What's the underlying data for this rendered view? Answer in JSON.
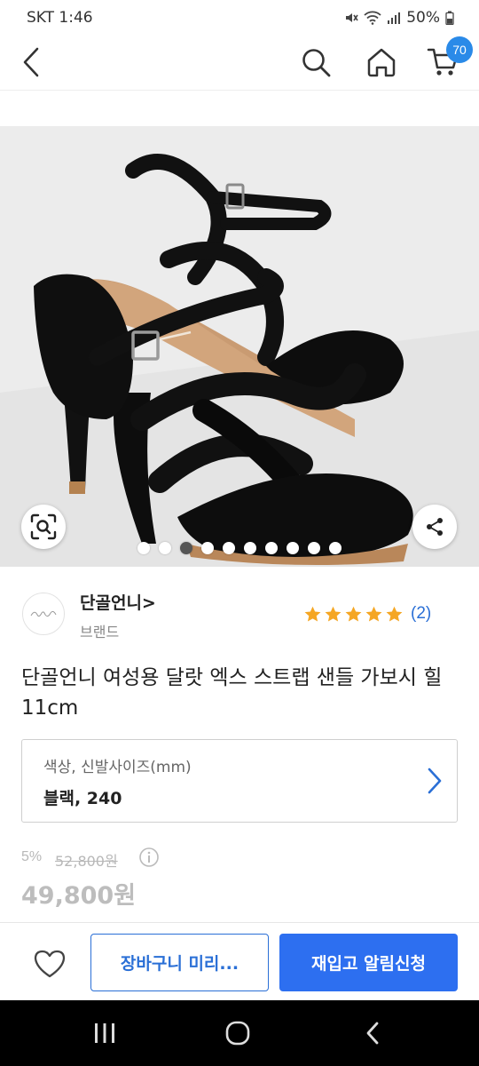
{
  "status_bar": {
    "carrier_time": "SKT 1:46",
    "battery": "50%",
    "icons": [
      "mute-icon",
      "wifi-icon",
      "signal-icon",
      "battery-icon"
    ]
  },
  "app_bar": {
    "icons": [
      "back-arrow-icon",
      "search-icon",
      "home-icon",
      "cart-icon"
    ],
    "cart_count": "70",
    "badge_color": "#2a8ae8"
  },
  "product_image": {
    "subject": "black strappy high-heel sandals",
    "slide_count": 10,
    "active_slide": 3
  },
  "brand": {
    "name": "단골언니>",
    "subtitle": "브랜드",
    "rating_stars": 5,
    "rating_count": "(2)",
    "star_color": "#f5a623"
  },
  "product": {
    "title": "단골언니 여성용 달랏 엑스 스트랩 샌들 가보시 힐 11cm"
  },
  "option": {
    "label": "색상, 신발사이즈(mm)",
    "value": "블랙, 240"
  },
  "price": {
    "discount_rate": "5%",
    "original": "52,800원",
    "sale": "49,800원"
  },
  "actions": {
    "add_to_cart": "장바구니 미리...",
    "restock_alert": "재입고 알림신청",
    "primary_color": "#2d6ff0"
  },
  "nav_bar": {
    "icons": [
      "recent-apps-icon",
      "home-circle-icon",
      "back-chevron-icon"
    ]
  }
}
